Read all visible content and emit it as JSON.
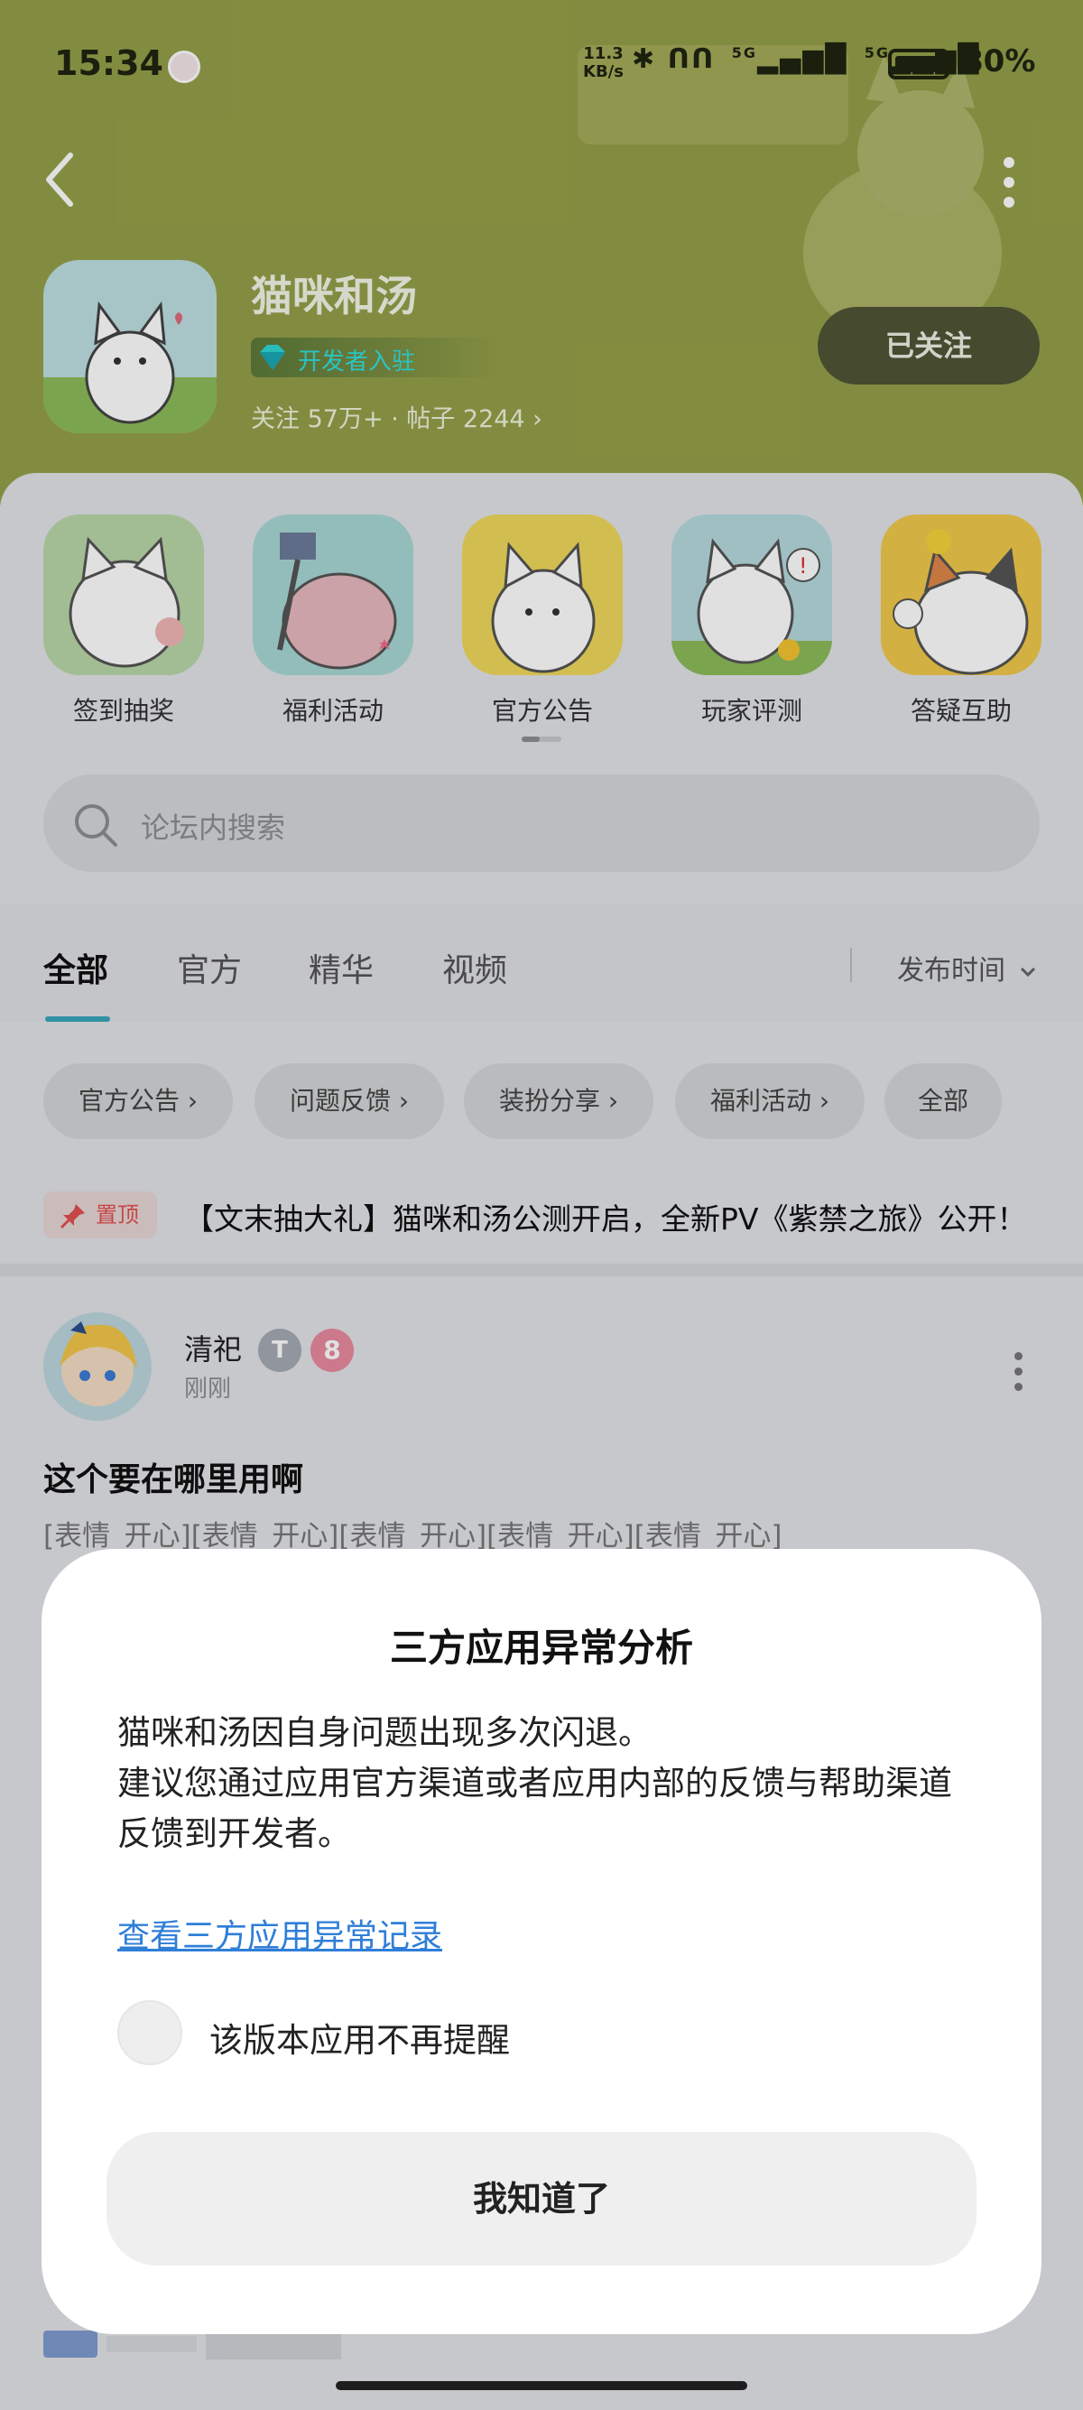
{
  "status_bar": {
    "time": "15:34",
    "net_speed_value": "11.3",
    "net_speed_unit": "KB/s",
    "network_1": "5G",
    "network_2": "5G",
    "battery": "80%"
  },
  "header": {
    "app_name": "猫咪和汤",
    "badge": "开发者入驻",
    "stats": "关注 57万+ · 帖子 2244 ›",
    "follow_label": "已关注"
  },
  "shortcuts": [
    {
      "label": "签到抽奖"
    },
    {
      "label": "福利活动"
    },
    {
      "label": "官方公告"
    },
    {
      "label": "玩家评测"
    },
    {
      "label": "答疑互助"
    }
  ],
  "search": {
    "placeholder": "论坛内搜索"
  },
  "tabs": [
    {
      "label": "全部",
      "active": true
    },
    {
      "label": "官方"
    },
    {
      "label": "精华"
    },
    {
      "label": "视频"
    }
  ],
  "sort": {
    "label": "发布时间"
  },
  "chips": [
    {
      "label": "官方公告 ›"
    },
    {
      "label": "问题反馈 ›"
    },
    {
      "label": "装扮分享 ›"
    },
    {
      "label": "福利活动 ›"
    },
    {
      "label": "全部"
    }
  ],
  "pinned": {
    "tag": "置顶",
    "title": "【文末抽大礼】猫咪和汤公测开启，全新PV《紫禁之旅》公开！"
  },
  "post": {
    "username": "清祀",
    "level_badge_1": "T",
    "level_badge_2": "8",
    "time": "刚刚",
    "title": "这个要在哪里用啊",
    "body": "[表情_开心][表情_开心][表情_开心][表情_开心][表情_开心]"
  },
  "dialog": {
    "title": "三方应用异常分析",
    "message_line1": "猫咪和汤因自身问题出现多次闪退。",
    "message_line2": "建议您通过应用官方渠道或者应用内部的反馈与帮助渠道反馈到开发者。",
    "link": "查看三方应用异常记录",
    "checkbox_label": "该版本应用不再提醒",
    "button": "我知道了"
  }
}
